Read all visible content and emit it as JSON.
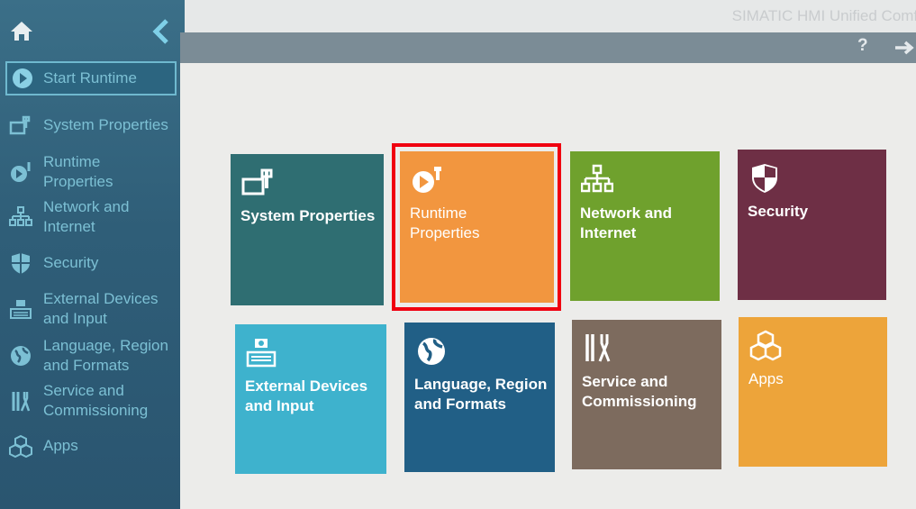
{
  "app_title": "SIMATIC HMI Unified Comfort",
  "toolbar": {
    "help": "?"
  },
  "sidebar": {
    "start_runtime": "Start Runtime",
    "items": [
      {
        "label": "System Properties",
        "icon": "system-properties-icon"
      },
      {
        "label": "Runtime Properties",
        "icon": "runtime-properties-icon"
      },
      {
        "label": "Network and Internet",
        "icon": "network-icon"
      },
      {
        "label": "Security",
        "icon": "shield-icon"
      },
      {
        "label": "External Devices and Input",
        "icon": "external-devices-icon"
      },
      {
        "label": "Language, Region and Formats",
        "icon": "globe-icon"
      },
      {
        "label": "Service and Commissioning",
        "icon": "tools-icon"
      },
      {
        "label": "Apps",
        "icon": "apps-icon"
      }
    ]
  },
  "tiles": [
    {
      "label": "System Properties",
      "color": "#2f6e72"
    },
    {
      "label": "Runtime Properties",
      "color": "#f2963f",
      "highlighted": true
    },
    {
      "label": "Network and Internet",
      "color": "#6fa12d"
    },
    {
      "label": "Security",
      "color": "#6e2f45"
    },
    {
      "label": "External Devices and Input",
      "color": "#3eb2cd"
    },
    {
      "label": "Language, Region and Formats",
      "color": "#215f86"
    },
    {
      "label": "Service and Commissioning",
      "color": "#7d6b5e"
    },
    {
      "label": "Apps",
      "color": "#eda43a"
    }
  ]
}
